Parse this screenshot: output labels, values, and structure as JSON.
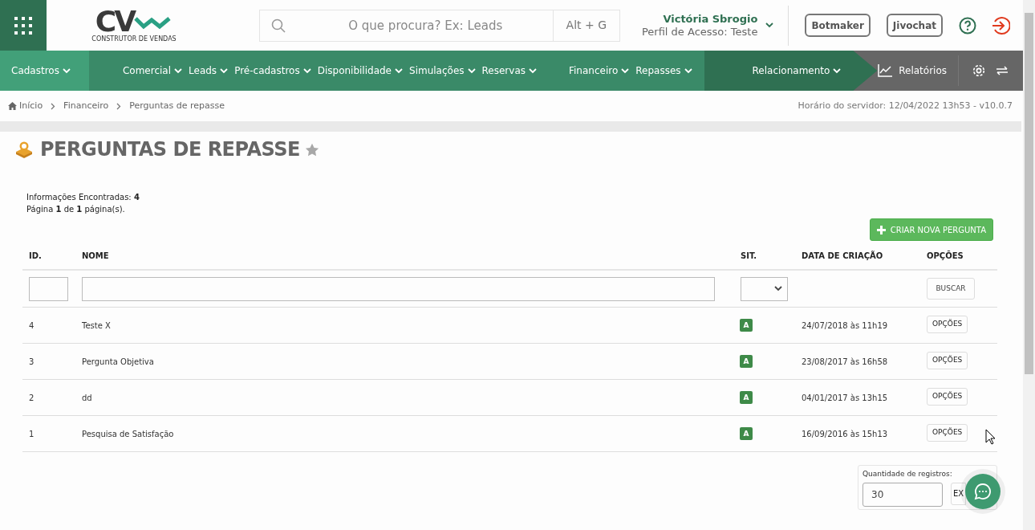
{
  "header": {
    "logo": {
      "mark": "CV",
      "tagline": "CONSTRUTOR DE VENDAS"
    },
    "search": {
      "placeholder": "O que procura? Ex: Leads",
      "shortcut": "Alt + G"
    },
    "user": {
      "name": "Victória Sbrogio",
      "profile": "Perfil de Acesso: Teste"
    },
    "buttons": [
      "Botmaker",
      "Jivochat"
    ]
  },
  "nav": {
    "groups": [
      {
        "items": [
          "Cadastros"
        ]
      },
      {
        "items": [
          "Comercial",
          "Leads",
          "Pré-cadastros",
          "Disponibilidade",
          "Simulações",
          "Reservas",
          "Financeiro",
          "Repasses"
        ]
      },
      {
        "items": [
          "Relacionamento"
        ]
      }
    ],
    "reports": "Relatórios"
  },
  "breadcrumb": [
    "Início",
    "Financeiro",
    "Perguntas de repasse"
  ],
  "server_time": "Horário do servidor: 12/04/2022 13h53 - v10.0.7",
  "page": {
    "title": "PERGUNTAS DE REPASSE",
    "favorite": false,
    "found": "Informações Encontradas: **4**",
    "pages": "Página **1** de **1** página(s).",
    "create_button": "CRIAR NOVA PERGUNTA"
  },
  "table": {
    "columns": [
      "ID.",
      "NOME",
      "SIT.",
      "DATA DE CRIAÇÃO",
      "OPÇÕES"
    ],
    "search_button": "BUSCAR",
    "rows": [
      {
        "id": "4",
        "name": "Teste X",
        "status": "A",
        "created": "24/07/2018 às 11h19",
        "options": "OPÇÕES"
      },
      {
        "id": "3",
        "name": "Pergunta Objetiva",
        "status": "A",
        "created": "23/08/2017 às 16h58",
        "options": "OPÇÕES"
      },
      {
        "id": "2",
        "name": "dd",
        "status": "A",
        "created": "04/01/2017 às 13h15",
        "options": "OPÇÕES"
      },
      {
        "id": "1",
        "name": "Pesquisa de Satisfação",
        "status": "A",
        "created": "16/09/2016 às 15h13",
        "options": "OPÇÕES"
      }
    ]
  },
  "records": {
    "label": "Quantidade de registros:",
    "value": "30",
    "button": "EX"
  }
}
